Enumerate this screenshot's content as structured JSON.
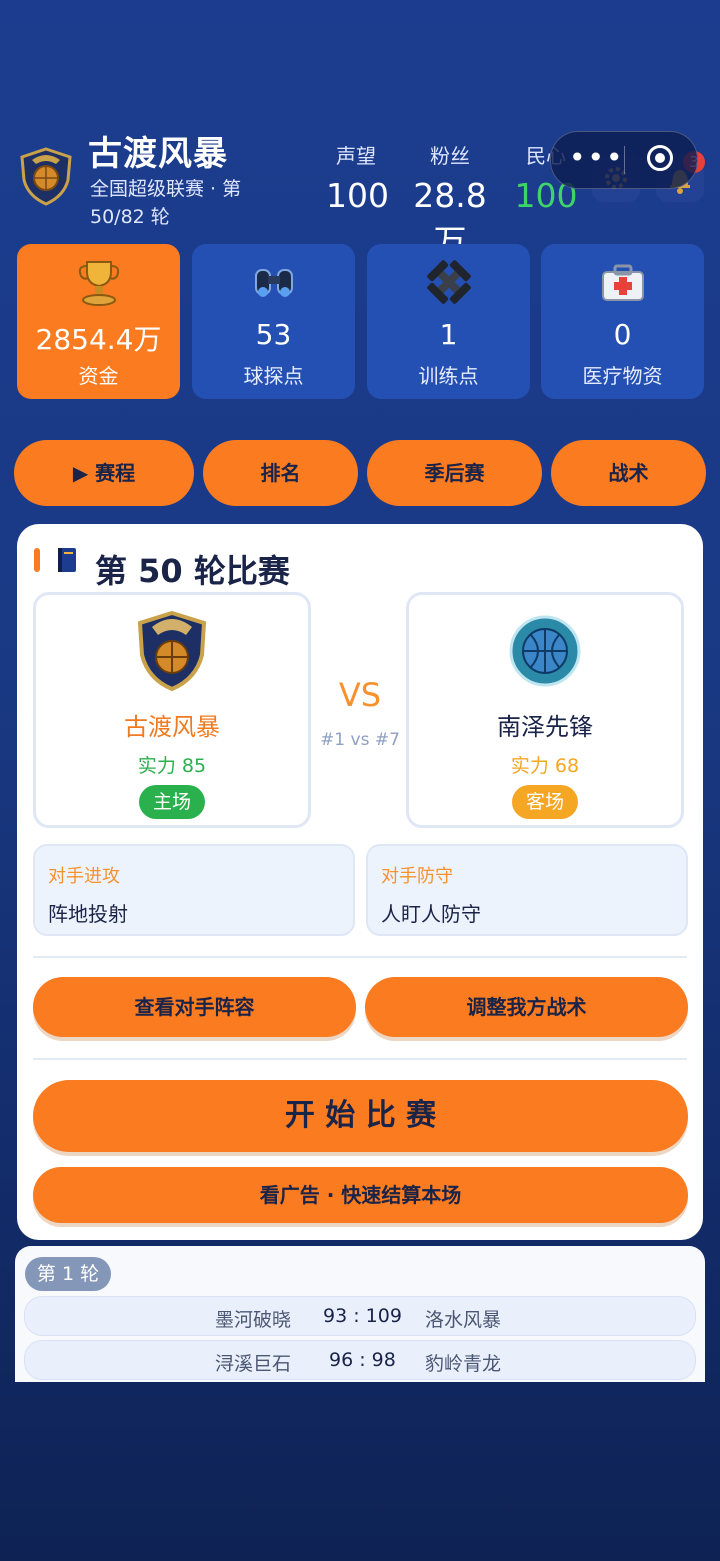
{
  "header": {
    "team_name": "古渡风暴",
    "league_info": "全国超级联赛 · 第50/82 轮",
    "stats": [
      {
        "label": "声望",
        "value": "100",
        "color": "#ffffff"
      },
      {
        "label": "粉丝",
        "value": "28.8万",
        "color": "#ffffff"
      },
      {
        "label": "民心",
        "value": "100",
        "color": "#3fd46a"
      }
    ],
    "notification_count": "3"
  },
  "resources": [
    {
      "value": "2854.4万",
      "label": "资金",
      "icon": "trophy-icon"
    },
    {
      "value": "53",
      "label": "球探点",
      "icon": "binoculars-icon"
    },
    {
      "value": "1",
      "label": "训练点",
      "icon": "dumbbell-icon"
    },
    {
      "value": "0",
      "label": "医疗物资",
      "icon": "medkit-icon"
    }
  ],
  "nav": {
    "schedule": "▶ 赛程",
    "ranking": "排名",
    "playoffs": "季后赛",
    "tactics": "战术"
  },
  "match": {
    "title": "第 50 轮比赛",
    "home": {
      "name": "古渡风暴",
      "power": "实力 85",
      "tag": "主场",
      "name_color": "#f07a20",
      "power_color": "#2bb04e",
      "tag_color": "#2bb04e"
    },
    "away": {
      "name": "南泽先锋",
      "power": "实力 68",
      "tag": "客场",
      "name_color": "#1a2348",
      "power_color": "#f5a623",
      "tag_color": "#f5a623"
    },
    "vs": "VS",
    "rank": "#1 vs #7",
    "opp_attack_label": "对手进攻",
    "opp_attack_value": "阵地投射",
    "opp_defense_label": "对手防守",
    "opp_defense_value": "人盯人防守",
    "view_lineup": "查看对手阵容",
    "adjust_tactics": "调整我方战术",
    "start": "开 始 比 赛",
    "quick_sim": "看广告 · 快速结算本场"
  },
  "results": {
    "round_label": "第 1 轮",
    "games": [
      {
        "home": "墨河破晓",
        "score": "93 : 109",
        "away": "洛水风暴"
      },
      {
        "home": "浔溪巨石",
        "score": "96 : 98",
        "away": "豹岭青龙"
      }
    ]
  },
  "colors": {
    "accent": "#fb7b20",
    "card": "#2550b3",
    "bg": "#1c3c8f"
  }
}
